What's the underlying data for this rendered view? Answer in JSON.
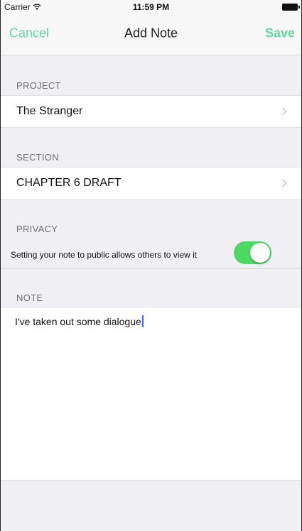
{
  "status_bar": {
    "carrier": "Carrier",
    "time": "11:59 PM",
    "wifi_icon": "wifi-icon",
    "battery_icon": "battery-icon"
  },
  "nav": {
    "cancel_label": "Cancel",
    "title": "Add Note",
    "save_label": "Save"
  },
  "project": {
    "header": "PROJECT",
    "value": "The Stranger"
  },
  "section": {
    "header": "SECTION",
    "value": "CHAPTER 6 DRAFT"
  },
  "privacy": {
    "header": "PRIVACY",
    "description": "Setting your note to public allows others to view it",
    "toggle_on": true
  },
  "note": {
    "header": "NOTE",
    "text": "I've taken out some dialogue"
  },
  "colors": {
    "accent": "#5fd8a0",
    "toggle_on": "#4cd964",
    "caret": "#3b6cf0",
    "background": "#efeff4"
  }
}
